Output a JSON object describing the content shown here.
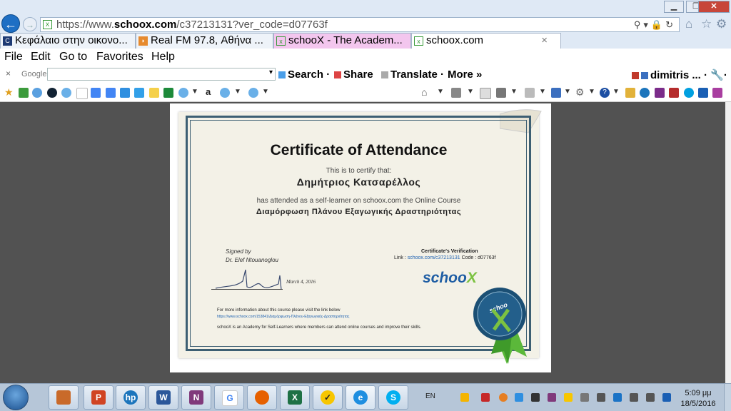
{
  "browser": {
    "url_prefix": "https://www.",
    "url_domain": "schoox.com",
    "url_suffix": "/c37213131?ver_code=d07763f",
    "tabs": [
      {
        "label": "Κεφάλαιο στην οικονο..."
      },
      {
        "label": "Real FM 97.8, Αθήνα ..."
      },
      {
        "label": "schooX - The Academ..."
      },
      {
        "label": "schoox.com"
      }
    ],
    "tab_close": "×",
    "menu": [
      "File",
      "Edit",
      "Go to",
      "Favorites",
      "Help"
    ]
  },
  "google_toolbar": {
    "close": "×",
    "logo": "Google",
    "search_label": "Search",
    "share_label": "Share",
    "translate_label": "Translate",
    "more_label": "More",
    "user_label": "dimitris ..."
  },
  "certificate": {
    "title": "Certificate of Attendance",
    "certify_text": "This is to certify that:",
    "recipient": "Δημήτριος Κατσαρέλλος",
    "attended_text": "has attended as a self-learner on schoox.com the Online Course",
    "course_name": "Διαμόρφωση Πλάνου Εξαγωγικής Δραστηριότητας",
    "signed_by": "Signed by",
    "signer": "Dr. Elef Ntouanoglou",
    "date": "March 4, 2016",
    "verification_title": "Certificate's Verification",
    "verification_link_label": "Link :",
    "verification_link": "schoox.com/c37213131",
    "verification_code": "Code : d07763f",
    "brand_main": "schoo",
    "brand_x": "X",
    "seal_text": "schoo",
    "more_info": "For more information about this course please visit the link below",
    "more_link": "https://www.schoox.com/153841/Διαμόρφωση-Πλάνου-Εξαγωγικής-Δραστηριότητας",
    "tagline": "schooX is an Academy for Self-Learners where members can attend online courses and improve their skills."
  },
  "taskbar": {
    "language": "EN",
    "time": "5:09 μμ",
    "date": "18/5/2016"
  },
  "colors": {
    "border": "#3d5f73",
    "brand_blue": "#1f5ea4",
    "brand_green": "#7cc241",
    "seal": "#1f5e86"
  }
}
